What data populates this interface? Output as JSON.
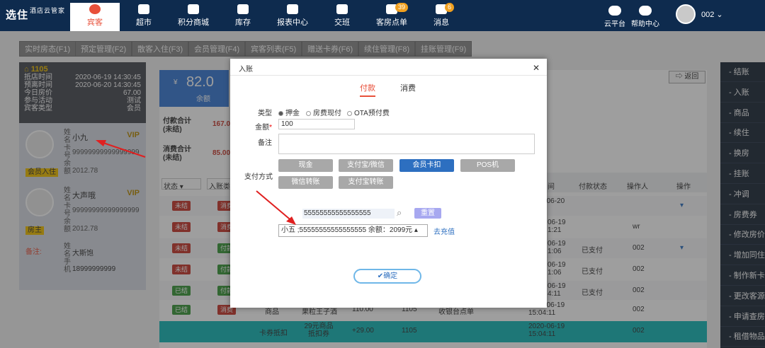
{
  "app": {
    "logo": "选住",
    "logo_sub": "酒店云管家"
  },
  "nav": [
    {
      "label": "宾客",
      "icon": "guest-icon",
      "active": true
    },
    {
      "label": "超市",
      "icon": "cart-icon"
    },
    {
      "label": "积分商城",
      "icon": "shop-icon"
    },
    {
      "label": "库存",
      "icon": "box-icon"
    },
    {
      "label": "报表中心",
      "icon": "report-icon"
    },
    {
      "label": "交班",
      "icon": "shift-icon"
    },
    {
      "label": "客房点单",
      "icon": "order-icon",
      "badge": "39"
    },
    {
      "label": "消息",
      "icon": "message-icon",
      "badge": "6"
    }
  ],
  "right_nav": {
    "cloud": "云平台",
    "help": "帮助中心",
    "user": "002"
  },
  "tabs": [
    "实时房态(F1)",
    "预定管理(F2)",
    "散客入住(F3)",
    "会员管理(F4)",
    "宾客列表(F5)",
    "赠送卡券(F6)",
    "续住管理(F8)",
    "挂账管理(F9)"
  ],
  "room": {
    "no": "1105",
    "checkin_label": "抵店时间",
    "checkin": "2020-06-19 14:30:45",
    "leave_label": "预离时间",
    "leave": "2020-06-20 14:30:45",
    "price_label": "今日房价",
    "price": "67.00",
    "activity_label": "参与活动",
    "activity": "测试",
    "type_label": "宾客类型",
    "type": "会员"
  },
  "guests": [
    {
      "name": "小九",
      "card": "99999999999999999",
      "amount": "2012.78",
      "tag": "会员入住",
      "vip": "VIP",
      "vert": "姓名卡号余额"
    },
    {
      "name": "大声哦",
      "card": "99999999999999999",
      "amount": "2012.78",
      "tag": "房主",
      "vip": "VIP",
      "vert": "姓名卡号余额"
    }
  ],
  "remark": {
    "label": "备注:",
    "name": "大斯饱",
    "phone": "18999999999",
    "vert": "姓名手机"
  },
  "balance": {
    "value": "82.0",
    "label": "余额"
  },
  "summary": [
    {
      "label": "付款合计\n(未结)",
      "value": "167.0"
    },
    {
      "label": "消费合计\n(未结)",
      "value": "85.00"
    }
  ],
  "filters": {
    "status": "状态",
    "type": "入账类"
  },
  "return_btn": "返回",
  "table_headers": {
    "time": "间",
    "pay_status": "付款状态",
    "operator": "操作人",
    "action": "操作"
  },
  "rows": [
    {
      "status": "未结",
      "type": "消费",
      "time": "2020-06-20\n10:12",
      "pay_status": "",
      "operator": ""
    },
    {
      "status": "未结",
      "type": "消费",
      "time": "06-19\n1:21",
      "pay_status": "",
      "operator": "wr"
    },
    {
      "status": "未结",
      "type": "付款",
      "time": "06-19\n1:06",
      "pay_status": "已支付",
      "operator": "002"
    },
    {
      "status": "未结",
      "type": "付款",
      "time": "06-19\n1:06",
      "pay_status": "已支付",
      "operator": "002"
    },
    {
      "status": "已结",
      "type": "付款",
      "time": "06-19\n4:11",
      "pay_status": "已支付",
      "operator": "002"
    },
    {
      "status": "已结",
      "type": "消费",
      "time": "2020-06-19\n15:04:11",
      "pay_status": "",
      "operator": "002",
      "item": "商品",
      "item_name": "果粒王子酒",
      "amount": "110.00",
      "room": "1105",
      "src": "收银台点单"
    }
  ],
  "teal_row": {
    "type": "卡券抵扣",
    "name": "29元商品抵扣券",
    "amount": "+29.00",
    "room": "1105",
    "time": "2020-06-19\n15:04:11",
    "operator": "002"
  },
  "sidebar": [
    "结账",
    "入账",
    "商品",
    "续住",
    "换房",
    "挂账",
    "冲调",
    "房费券",
    "修改房价",
    "增加同住",
    "制作新卡",
    "更改客源",
    "申请查房",
    "租借物品"
  ],
  "dialog": {
    "title": "入账",
    "tab_pay": "付款",
    "tab_consume": "消费",
    "type_label": "类型",
    "types": [
      "押金",
      "房费现付",
      "OTA预付费"
    ],
    "amount_label": "金额",
    "amount": "100",
    "note_label": "备注",
    "paymethod_label": "支付方式",
    "methods": [
      "现金",
      "支付宝/微信",
      "会员卡扣",
      "POS机",
      "微信转账",
      "支付宝转账"
    ],
    "selected_method": "会员卡扣",
    "card_query": "55555555555555555",
    "reset": "重置",
    "member_select": "小五 ;55555555555555555 余额：2099元",
    "recharge": "去充值",
    "confirm": "确定"
  }
}
